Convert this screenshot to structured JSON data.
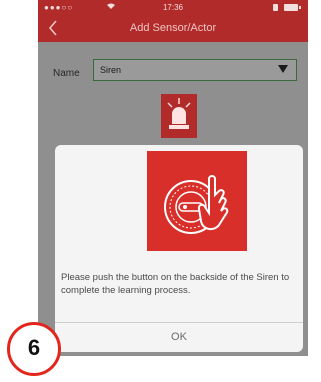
{
  "status_bar": {
    "carrier": "●●●○○",
    "time": "17:36"
  },
  "nav_bar": {
    "back_icon": "chevron-left-icon",
    "title": "Add Sensor/Actor"
  },
  "form": {
    "name_label": "Name",
    "name_value": "Siren"
  },
  "dialog": {
    "message": "Please push the button on the backside of the Siren to complete the learning process.",
    "ok_label": "OK"
  },
  "step_badge": {
    "number": "6"
  },
  "colors": {
    "brand_red": "#b22b2b",
    "dialog_image_red": "#d92f2a",
    "badge_red": "#e2261e"
  }
}
